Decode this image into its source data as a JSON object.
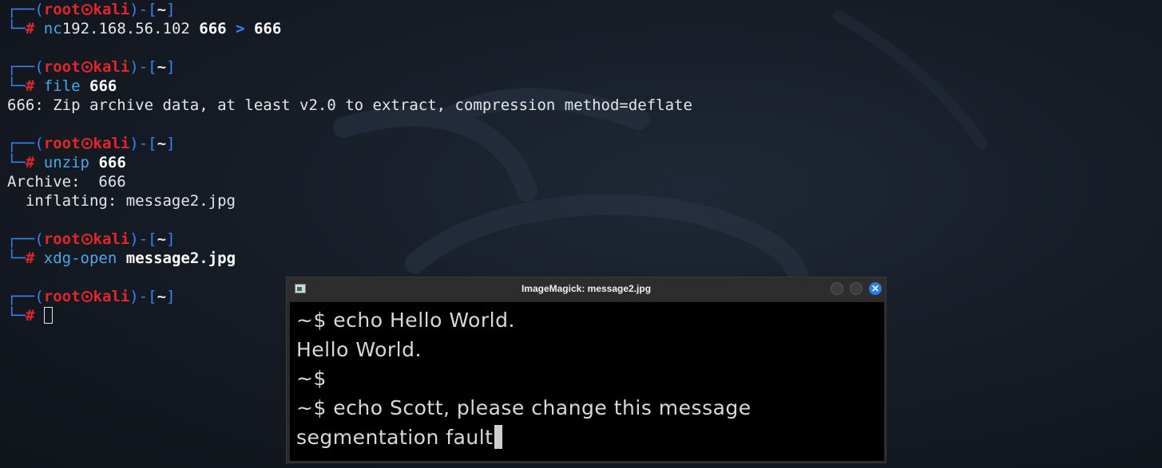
{
  "prompt": {
    "open": "┌──(",
    "user": "root",
    "host": "kali",
    "mid": ")-[",
    "dir": "~",
    "close": "]",
    "corner": "└─",
    "hash": "#"
  },
  "blocks": [
    {
      "cmd": "nc",
      "args": "192.168.56.102 ",
      "bold1": "666",
      "redir": " > ",
      "bold2": "666",
      "output": []
    },
    {
      "cmd": "file",
      "args": " ",
      "bold1": "666",
      "output": [
        "666: Zip archive data, at least v2.0 to extract, compression method=deflate"
      ]
    },
    {
      "cmd": "unzip",
      "args": " ",
      "bold1": "666",
      "output": [
        "Archive:  666",
        "  inflating: message2.jpg"
      ]
    },
    {
      "cmd": "xdg-open",
      "args": " ",
      "bold1": "message2.jpg",
      "output": []
    }
  ],
  "image_window": {
    "title": "ImageMagick: message2.jpg",
    "close_glyph": "✕",
    "lines": [
      "~$ echo Hello World.",
      "Hello World.",
      "~$",
      "~$ echo Scott, please change this message",
      "segmentation fault"
    ]
  },
  "colors": {
    "prompt_frame": "#3b82f6",
    "user_host": "#e3262b",
    "command": "#4aa8e8",
    "close_button": "#2b7de9"
  }
}
